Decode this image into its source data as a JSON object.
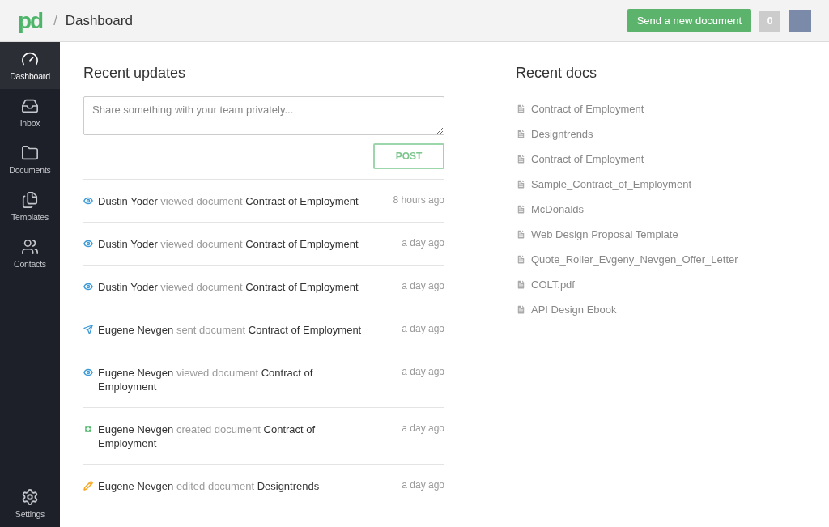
{
  "header": {
    "logo": "pd",
    "separator": "/",
    "title": "Dashboard",
    "send_button": "Send a new document",
    "notification_count": "0"
  },
  "sidebar": {
    "items": [
      {
        "label": "Dashboard",
        "kind": "dashboard",
        "selected": true
      },
      {
        "label": "Inbox",
        "kind": "inbox",
        "selected": false
      },
      {
        "label": "Documents",
        "kind": "documents",
        "selected": false
      },
      {
        "label": "Templates",
        "kind": "templates",
        "selected": false
      },
      {
        "label": "Contacts",
        "kind": "contacts",
        "selected": false
      }
    ],
    "settings": {
      "label": "Settings",
      "selected": false
    }
  },
  "recent_updates": {
    "title": "Recent updates",
    "share_placeholder": "Share something with your team privately...",
    "post_button": "POST",
    "items": [
      {
        "kind": "viewed",
        "actor": "Dustin Yoder",
        "action": "viewed document",
        "document": "Contract of Employment",
        "time": "8 hours ago"
      },
      {
        "kind": "viewed",
        "actor": "Dustin Yoder",
        "action": "viewed document",
        "document": "Contract of Employment",
        "time": "a day ago"
      },
      {
        "kind": "viewed",
        "actor": "Dustin Yoder",
        "action": "viewed document",
        "document": "Contract of Employment",
        "time": "a day ago"
      },
      {
        "kind": "sent",
        "actor": "Eugene Nevgen",
        "action": "sent document",
        "document": "Contract of Employment",
        "time": "a day ago"
      },
      {
        "kind": "viewed",
        "actor": "Eugene Nevgen",
        "action": "viewed document",
        "document": "Contract of Employment",
        "time": "a day ago"
      },
      {
        "kind": "created",
        "actor": "Eugene Nevgen",
        "action": "created document",
        "document": "Contract of Employment",
        "time": "a day ago"
      },
      {
        "kind": "edited",
        "actor": "Eugene Nevgen",
        "action": "edited document",
        "document": "Designtrends",
        "time": "a day ago"
      }
    ]
  },
  "recent_docs": {
    "title": "Recent docs",
    "items": [
      "Contract of Employment",
      "Designtrends",
      "Contract of Employment",
      "Sample_Contract_of_Employment",
      "McDonalds",
      "Web Design Proposal Template",
      "Quote_Roller_Evgeny_Nevgen_Offer_Letter",
      "COLT.pdf",
      "API Design Ebook"
    ]
  }
}
